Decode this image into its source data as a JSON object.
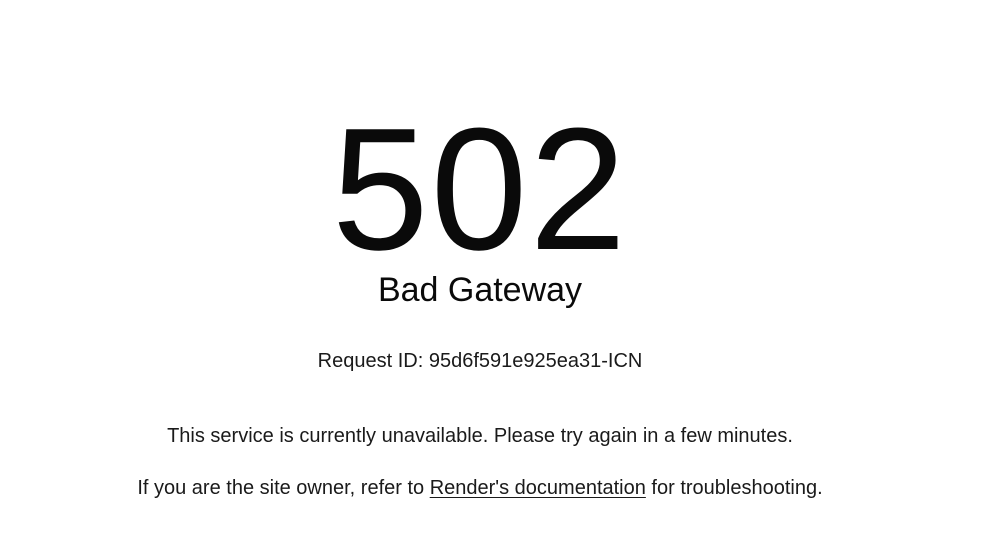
{
  "error": {
    "code": "502",
    "status": "Bad Gateway",
    "request_id_label": "Request ID:",
    "request_id": "95d6f591e925ea31-ICN"
  },
  "messages": {
    "unavailable": "This service is currently unavailable. Please try again in a few minutes.",
    "owner_prefix": "If you are the site owner, refer to ",
    "docs_link": "Render's documentation",
    "owner_suffix": " for troubleshooting."
  }
}
